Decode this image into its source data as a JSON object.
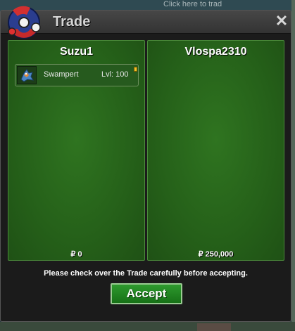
{
  "background": {
    "top_text": "Click here to trad"
  },
  "window": {
    "title": "Trade",
    "close_glyph": "✕"
  },
  "panels": {
    "left": {
      "player": "Suzu1",
      "pokemon": {
        "icon": "swampert-sprite-icon",
        "name": "Swampert",
        "level": "Lvl: 100"
      },
      "money": "₽ 0"
    },
    "right": {
      "player": "Vlospa2310",
      "money": "₽ 250,000"
    }
  },
  "notice": "Please check over the Trade carefully before accepting.",
  "accept_label": "Accept",
  "colors": {
    "panel_green": "#256019",
    "button_green": "#1f8a1f",
    "title": "#d6d6d6"
  }
}
